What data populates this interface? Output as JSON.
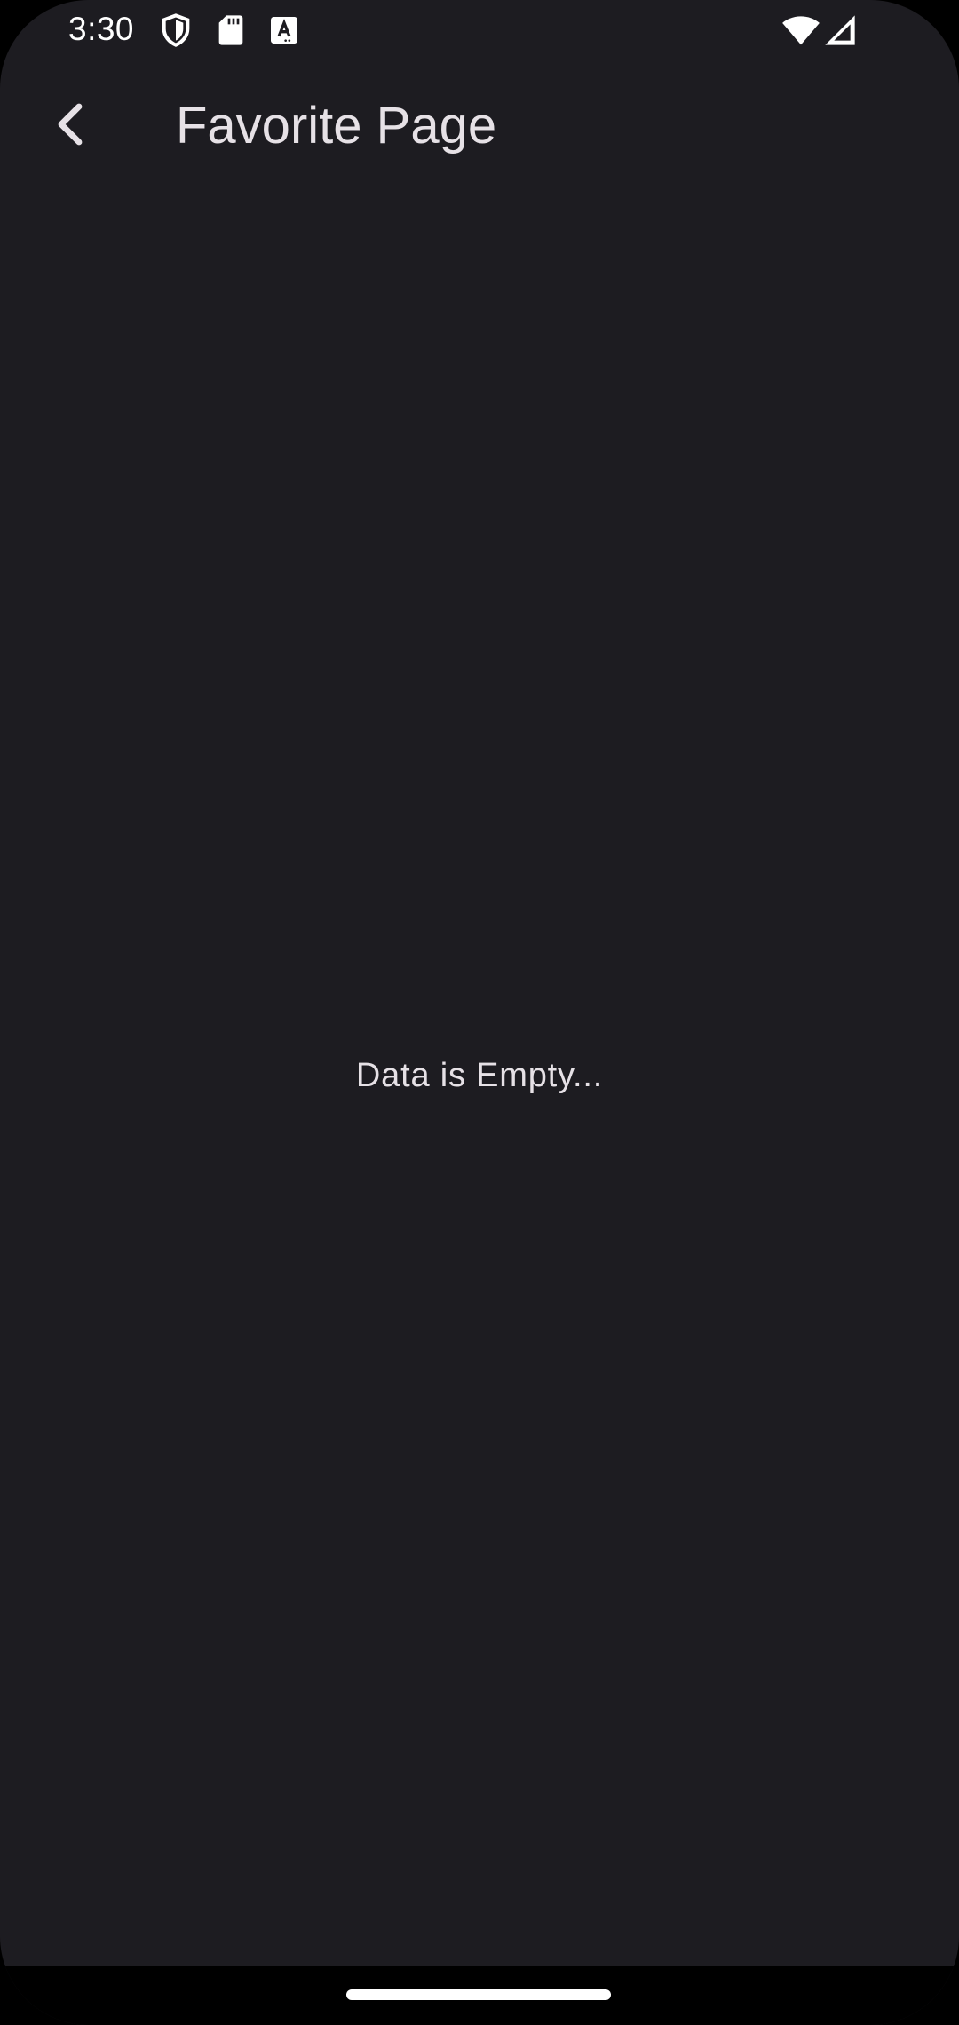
{
  "status_bar": {
    "time": "3:30",
    "left_icons": [
      "shield-icon",
      "sd-card-icon",
      "font-download-icon"
    ],
    "right_icons": [
      "wifi-icon",
      "cellular-signal-icon"
    ]
  },
  "app_bar": {
    "back_icon": "chevron-left-icon",
    "title": "Favorite Page"
  },
  "content": {
    "empty_message": "Data is Empty..."
  },
  "colors": {
    "background": "#1d1c21",
    "text": "#e6e1e6",
    "status_text": "#ffffff",
    "nav_bar": "#000000"
  }
}
